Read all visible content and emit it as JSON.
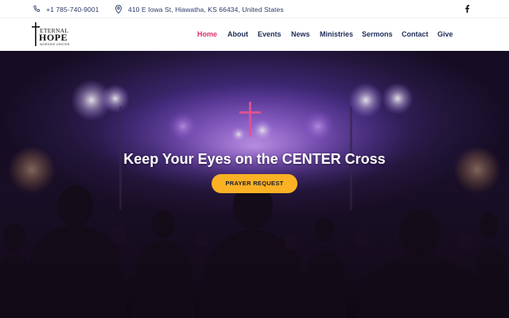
{
  "topbar": {
    "phone": "+1 785-740-9001",
    "address": "410 E Iowa St, Hiawatha, KS 66434, United States",
    "phone_icon": "phone-icon",
    "address_icon": "map-pin-icon",
    "social_icon": "facebook-icon"
  },
  "logo": {
    "line1": "ETERNAL",
    "line2": "HOPE",
    "line3": "WORSHIP CENTER",
    "icon": "cross-icon"
  },
  "nav": {
    "items": [
      {
        "label": "Home",
        "active": true
      },
      {
        "label": "About",
        "active": false
      },
      {
        "label": "Events",
        "active": false
      },
      {
        "label": "News",
        "active": false
      },
      {
        "label": "Ministries",
        "active": false
      },
      {
        "label": "Sermons",
        "active": false
      },
      {
        "label": "Contact",
        "active": false
      },
      {
        "label": "Give",
        "active": false
      }
    ]
  },
  "hero": {
    "title": "Keep Your Eyes on the CENTER Cross",
    "button_label": "PRAYER REQUEST"
  },
  "colors": {
    "nav_text": "#1c2b55",
    "nav_active": "#e0306b",
    "button_bg": "#fbb124",
    "stage_purple": "#6b45b0"
  }
}
